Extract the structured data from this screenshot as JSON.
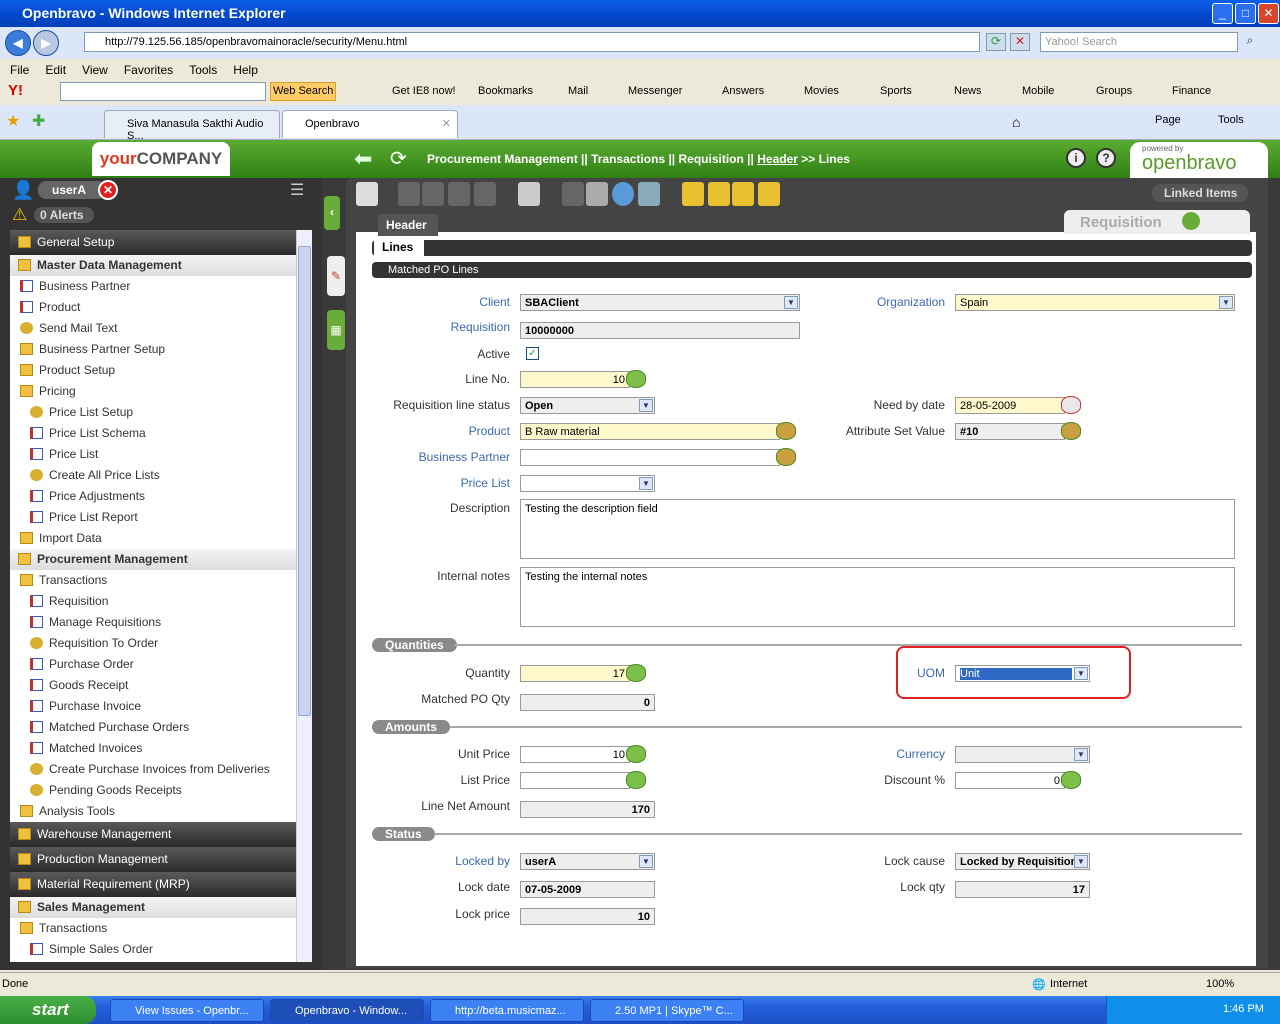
{
  "window": {
    "title": "Openbravo - Windows Internet Explorer"
  },
  "browser": {
    "address": "http://79.125.56.185/openbravomainoracle/security/Menu.html",
    "search_placeholder": "Yahoo! Search",
    "menu": [
      "File",
      "Edit",
      "View",
      "Favorites",
      "Tools",
      "Help"
    ],
    "ytoolbar": {
      "web_search": "Web Search",
      "items": [
        "Get IE8 now!",
        "Bookmarks",
        "Mail",
        "Messenger",
        "Answers",
        "Movies",
        "Sports",
        "News",
        "Mobile",
        "Groups",
        "Finance"
      ]
    },
    "tabs": [
      "Siva Manasula Sakthi Audio S...",
      "Openbravo"
    ],
    "cmd": {
      "page": "Page",
      "tools": "Tools"
    }
  },
  "app": {
    "logo_your": "your",
    "logo_company": "COMPANY",
    "breadcrumb": {
      "p1": "Procurement Management || Transactions || Requisition ||",
      "header": "Header",
      "p2": ">> Lines"
    },
    "powered_by": "powered by",
    "brand": "openbravo",
    "user": "userA",
    "alerts": "0 Alerts",
    "linked_items": "Linked Items",
    "window_name": "Requisition"
  },
  "nav": [
    {
      "label": "General Setup",
      "kind": "sec"
    },
    {
      "label": "Master Data Management",
      "kind": "grp"
    },
    {
      "label": "Business Partner",
      "kind": "doc",
      "lvl": 1
    },
    {
      "label": "Product",
      "kind": "doc",
      "lvl": 1
    },
    {
      "label": "Send Mail Text",
      "kind": "gear",
      "lvl": 1
    },
    {
      "label": "Business Partner Setup",
      "kind": "fold",
      "lvl": 1
    },
    {
      "label": "Product Setup",
      "kind": "fold",
      "lvl": 1
    },
    {
      "label": "Pricing",
      "kind": "fold",
      "lvl": 1
    },
    {
      "label": "Price List Setup",
      "kind": "gear",
      "lvl": 2
    },
    {
      "label": "Price List Schema",
      "kind": "doc",
      "lvl": 2
    },
    {
      "label": "Price List",
      "kind": "doc",
      "lvl": 2
    },
    {
      "label": "Create All Price Lists",
      "kind": "gear",
      "lvl": 2
    },
    {
      "label": "Price Adjustments",
      "kind": "doc",
      "lvl": 2
    },
    {
      "label": "Price List Report",
      "kind": "doc",
      "lvl": 2
    },
    {
      "label": "Import Data",
      "kind": "fold",
      "lvl": 1
    },
    {
      "label": "Procurement Management",
      "kind": "grp"
    },
    {
      "label": "Transactions",
      "kind": "fold",
      "lvl": 1
    },
    {
      "label": "Requisition",
      "kind": "doc",
      "lvl": 2
    },
    {
      "label": "Manage Requisitions",
      "kind": "doc",
      "lvl": 2
    },
    {
      "label": "Requisition To Order",
      "kind": "gear",
      "lvl": 2
    },
    {
      "label": "Purchase Order",
      "kind": "doc",
      "lvl": 2
    },
    {
      "label": "Goods Receipt",
      "kind": "doc",
      "lvl": 2
    },
    {
      "label": "Purchase Invoice",
      "kind": "doc",
      "lvl": 2
    },
    {
      "label": "Matched Purchase Orders",
      "kind": "doc",
      "lvl": 2
    },
    {
      "label": "Matched Invoices",
      "kind": "doc",
      "lvl": 2
    },
    {
      "label": "Create Purchase Invoices from Deliveries",
      "kind": "gear",
      "lvl": 2
    },
    {
      "label": "Pending Goods Receipts",
      "kind": "gear",
      "lvl": 2
    },
    {
      "label": "Analysis Tools",
      "kind": "fold",
      "lvl": 1
    },
    {
      "label": "Warehouse Management",
      "kind": "sec"
    },
    {
      "label": "Production Management",
      "kind": "sec"
    },
    {
      "label": "Material Requirement (MRP)",
      "kind": "sec"
    },
    {
      "label": "Sales Management",
      "kind": "grp"
    },
    {
      "label": "Transactions",
      "kind": "fold",
      "lvl": 1
    },
    {
      "label": "Simple Sales Order",
      "kind": "doc",
      "lvl": 2
    }
  ],
  "tabs": {
    "header": "Header",
    "lines": "Lines",
    "matched": "Matched PO Lines"
  },
  "form": {
    "client": {
      "label": "Client",
      "value": "SBAClient"
    },
    "organization": {
      "label": "Organization",
      "value": "Spain"
    },
    "requisition": {
      "label": "Requisition",
      "value": "10000000"
    },
    "active": {
      "label": "Active",
      "checked": true,
      "mark": "✓"
    },
    "line_no": {
      "label": "Line No.",
      "value": "10"
    },
    "status": {
      "label": "Requisition line status",
      "value": "Open"
    },
    "need_by": {
      "label": "Need by date",
      "value": "28-05-2009"
    },
    "product": {
      "label": "Product",
      "value": "B Raw material"
    },
    "attr_set": {
      "label": "Attribute Set Value",
      "value": "#10"
    },
    "bpartner": {
      "label": "Business Partner",
      "value": ""
    },
    "price_list": {
      "label": "Price List",
      "value": ""
    },
    "description": {
      "label": "Description",
      "value": "Testing the description field"
    },
    "internal_notes": {
      "label": "Internal notes",
      "value": "Testing the internal notes"
    },
    "sections": {
      "quantities": "Quantities",
      "amounts": "Amounts",
      "status": "Status"
    },
    "quantity": {
      "label": "Quantity",
      "value": "17"
    },
    "uom": {
      "label": "UOM",
      "value": "Unit"
    },
    "matched_qty": {
      "label": "Matched PO Qty",
      "value": "0"
    },
    "unit_price": {
      "label": "Unit Price",
      "value": "10"
    },
    "currency": {
      "label": "Currency",
      "value": ""
    },
    "list_price": {
      "label": "List Price",
      "value": ""
    },
    "discount": {
      "label": "Discount %",
      "value": "0"
    },
    "line_net": {
      "label": "Line Net Amount",
      "value": "170"
    },
    "locked_by": {
      "label": "Locked by",
      "value": "userA"
    },
    "lock_cause": {
      "label": "Lock cause",
      "value": "Locked by Requisition t"
    },
    "lock_date": {
      "label": "Lock date",
      "value": "07-05-2009"
    },
    "lock_qty": {
      "label": "Lock qty",
      "value": "17"
    },
    "lock_price": {
      "label": "Lock price",
      "value": "10"
    }
  },
  "statusbar": {
    "text": "Done",
    "zone": "Internet",
    "zoom": "100%"
  },
  "taskbar": {
    "start": "start",
    "items": [
      "View Issues - Openbr...",
      "Openbravo - Window...",
      "http://beta.musicmaz...",
      "2.50 MP1 | Skype™ C..."
    ],
    "time": "1:46 PM"
  },
  "colors": {
    "green": "#3a8a1e",
    "highlight": "#e02020",
    "select": "#316ac5"
  }
}
